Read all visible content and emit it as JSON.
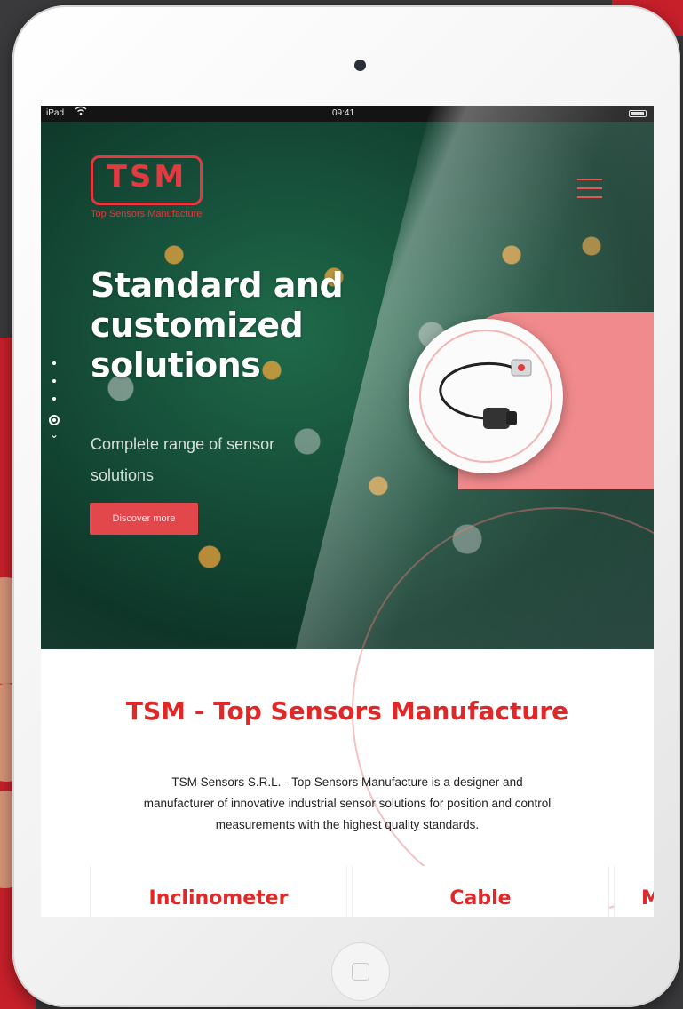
{
  "statusbar": {
    "device": "iPad",
    "wifi_icon": "wifi-icon",
    "time": "09:41"
  },
  "header": {
    "logo_text": "TSM",
    "logo_tagline": "Top Sensors Manufacture",
    "menu_icon": "hamburger-menu-icon"
  },
  "hero": {
    "headline": "Standard and customized solutions",
    "subheadline": "Complete range of sensor solutions",
    "cta_label": "Discover more",
    "slider_dots": 3
  },
  "about": {
    "title": "TSM - Top Sensors Manufacture",
    "description": "TSM Sensors S.R.L. - Top Sensors Manufacture is a designer and manufacturer of innovative industrial sensor solutions for position and control measurements with the highest quality standards."
  },
  "products": {
    "items": [
      {
        "label": "Inclinometer"
      },
      {
        "label": "Cable"
      },
      {
        "label": "M"
      }
    ]
  },
  "colors": {
    "brand_red": "#e02828",
    "button_red": "#e2474c",
    "panel_pink": "#f08a8c"
  }
}
